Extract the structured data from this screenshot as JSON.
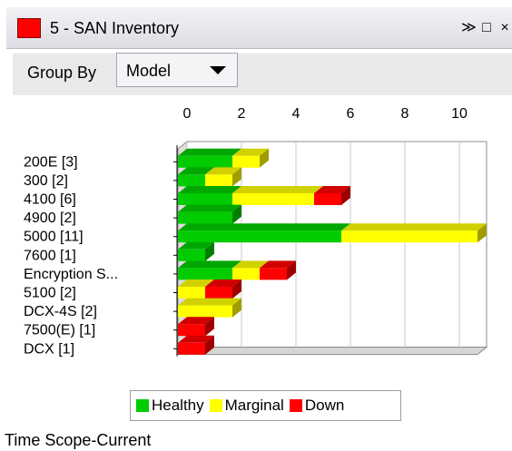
{
  "window": {
    "title": "5 - SAN Inventory",
    "swatch_color": "#ff0000",
    "controls": {
      "collapse_icon": "≫",
      "maximize_icon": "□",
      "close_icon": "×"
    }
  },
  "group_by": {
    "label": "Group By",
    "value": "Model"
  },
  "chart_data": {
    "type": "bar",
    "orientation": "horizontal",
    "stacked": true,
    "style": "3d",
    "x_ticks": [
      "0",
      "2",
      "4",
      "6",
      "8",
      "10"
    ],
    "xlim": [
      0,
      11
    ],
    "categories": [
      "200E [3]",
      "300 [2]",
      "4100 [6]",
      "4900 [2]",
      "5000 [11]",
      "7600 [1]",
      "Encryption S...",
      "5100 [2]",
      "DCX-4S [2]",
      "7500(E) [1]",
      "DCX [1]"
    ],
    "series": [
      {
        "name": "Healthy",
        "color": "#00cc00",
        "values": [
          2,
          1,
          2,
          2,
          6,
          1,
          2,
          0,
          0,
          0,
          0
        ]
      },
      {
        "name": "Marginal",
        "color": "#ffff00",
        "values": [
          1,
          1,
          3,
          0,
          5,
          0,
          1,
          1,
          2,
          0,
          0
        ]
      },
      {
        "name": "Down",
        "color": "#ff0000",
        "values": [
          0,
          0,
          1,
          0,
          0,
          0,
          1,
          1,
          0,
          1,
          1
        ]
      }
    ],
    "grid": true,
    "legend_position": "bottom"
  },
  "footer": {
    "time_scope": "Time Scope-Current"
  }
}
